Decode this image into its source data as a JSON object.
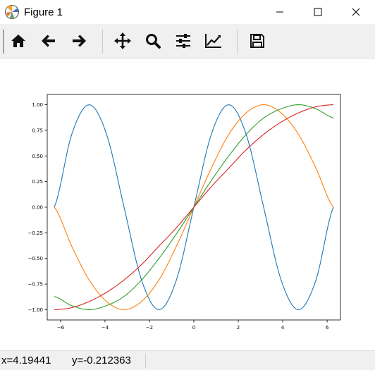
{
  "window": {
    "title": "Figure 1"
  },
  "toolbar": {
    "buttons": [
      {
        "icon": "home-icon"
      },
      {
        "icon": "back-arrow-icon"
      },
      {
        "icon": "forward-arrow-icon"
      },
      {
        "icon": "pan-icon"
      },
      {
        "icon": "zoom-icon"
      },
      {
        "icon": "subplots-icon"
      },
      {
        "icon": "edit-axis-icon"
      },
      {
        "icon": "save-icon"
      }
    ]
  },
  "status": {
    "x_text": "x=4.19441",
    "y_text": "y=-0.212363"
  },
  "chart_data": {
    "type": "line",
    "title": "",
    "xlabel": "",
    "ylabel": "",
    "xlim": [
      -6.6,
      6.6
    ],
    "ylim": [
      -1.1,
      1.1
    ],
    "xticks": [
      -6,
      -4,
      -2,
      0,
      2,
      4,
      6
    ],
    "xtick_labels": [
      "−6",
      "−4",
      "−2",
      "0",
      "2",
      "4",
      "6"
    ],
    "yticks": [
      1.0,
      0.75,
      0.5,
      0.25,
      0.0,
      -0.25,
      -0.5,
      -0.75,
      -1.0
    ],
    "ytick_labels": [
      "1.00",
      "0.75",
      "0.50",
      "0.25",
      "0.00",
      "−0.25",
      "−0.50",
      "−0.75",
      "−1.00"
    ],
    "x_range": [
      -6.2832,
      6.2832
    ],
    "series": [
      {
        "color": "#1f77b4",
        "x": [
          -6.283,
          -5.498,
          -4.712,
          -3.927,
          -3.142,
          -2.356,
          -1.571,
          -0.785,
          0,
          0.785,
          1.571,
          2.356,
          3.142,
          3.927,
          4.712,
          5.498,
          6.283
        ],
        "values": [
          0.0,
          0.71,
          1.0,
          0.71,
          0.0,
          -0.71,
          -1.0,
          -0.71,
          0.0,
          0.71,
          1.0,
          0.71,
          0.0,
          -0.71,
          -1.0,
          -0.71,
          0.0
        ]
      },
      {
        "color": "#ff7f0e",
        "x": [
          -6.283,
          -5.498,
          -4.712,
          -3.927,
          -3.142,
          -2.356,
          -1.571,
          -0.785,
          0,
          0.785,
          1.571,
          2.356,
          3.142,
          3.927,
          4.712,
          5.498,
          6.283
        ],
        "values": [
          0.0,
          -0.38,
          -0.71,
          -0.92,
          -1.0,
          -0.92,
          -0.71,
          -0.38,
          0.0,
          0.38,
          0.71,
          0.92,
          1.0,
          0.92,
          0.71,
          0.38,
          0.0
        ]
      },
      {
        "color": "#2ca02c",
        "x": [
          -6.283,
          -5.498,
          -4.712,
          -3.927,
          -3.142,
          -2.356,
          -1.571,
          -0.785,
          0,
          0.785,
          1.571,
          2.356,
          3.142,
          3.927,
          4.712,
          5.498,
          6.283
        ],
        "values": [
          -0.87,
          -0.96,
          -1.0,
          -0.96,
          -0.87,
          -0.71,
          -0.5,
          -0.26,
          0.0,
          0.26,
          0.5,
          0.71,
          0.87,
          0.96,
          1.0,
          0.96,
          0.87
        ]
      },
      {
        "color": "#d62728",
        "x": [
          -6.283,
          -5.498,
          -4.712,
          -3.927,
          -3.142,
          -2.356,
          -1.571,
          -0.785,
          0,
          0.785,
          1.571,
          2.356,
          3.142,
          3.927,
          4.712,
          5.498,
          6.283
        ],
        "values": [
          -1.0,
          -0.98,
          -0.92,
          -0.83,
          -0.71,
          -0.56,
          -0.38,
          -0.2,
          0.0,
          0.2,
          0.38,
          0.56,
          0.71,
          0.83,
          0.92,
          0.98,
          1.0
        ]
      }
    ]
  }
}
